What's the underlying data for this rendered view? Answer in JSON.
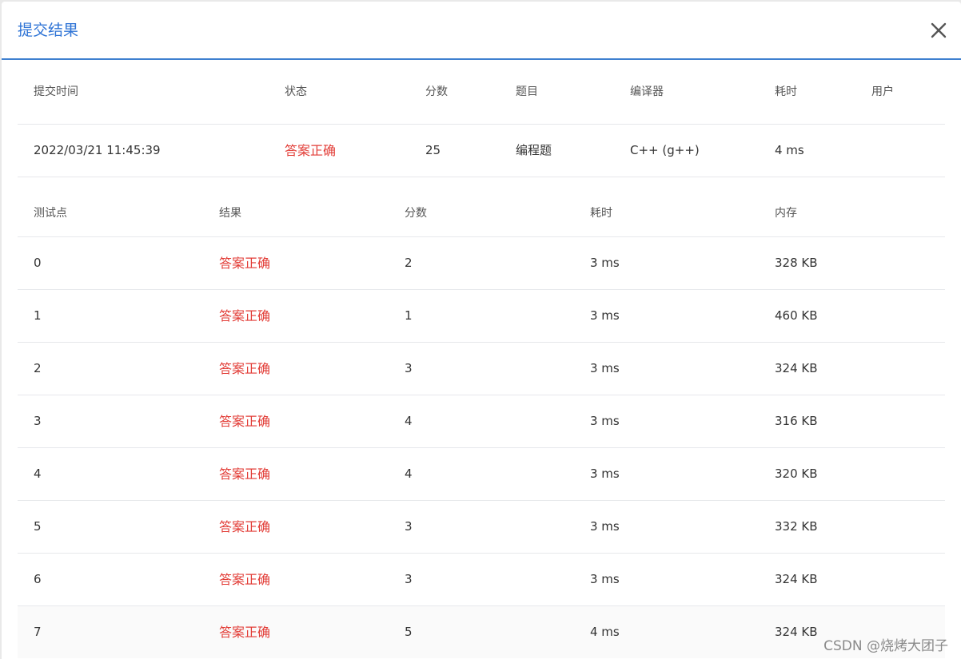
{
  "dialog": {
    "title": "提交结果"
  },
  "summary": {
    "headers": [
      "提交时间",
      "状态",
      "分数",
      "题目",
      "编译器",
      "耗时",
      "用户"
    ],
    "row": {
      "time": "2022/03/21 11:45:39",
      "status": "答案正确",
      "score": "25",
      "problem": "编程题",
      "compiler": "C++ (g++)",
      "elapsed": "4 ms",
      "user": ""
    }
  },
  "tests": {
    "headers": [
      "测试点",
      "结果",
      "分数",
      "耗时",
      "内存"
    ],
    "rows": [
      {
        "id": "0",
        "result": "答案正确",
        "score": "2",
        "time": "3 ms",
        "memory": "328 KB"
      },
      {
        "id": "1",
        "result": "答案正确",
        "score": "1",
        "time": "3 ms",
        "memory": "460 KB"
      },
      {
        "id": "2",
        "result": "答案正确",
        "score": "3",
        "time": "3 ms",
        "memory": "324 KB"
      },
      {
        "id": "3",
        "result": "答案正确",
        "score": "4",
        "time": "3 ms",
        "memory": "316 KB"
      },
      {
        "id": "4",
        "result": "答案正确",
        "score": "4",
        "time": "3 ms",
        "memory": "320 KB"
      },
      {
        "id": "5",
        "result": "答案正确",
        "score": "3",
        "time": "3 ms",
        "memory": "332 KB"
      },
      {
        "id": "6",
        "result": "答案正确",
        "score": "3",
        "time": "3 ms",
        "memory": "324 KB"
      },
      {
        "id": "7",
        "result": "答案正确",
        "score": "5",
        "time": "4 ms",
        "memory": "324 KB"
      }
    ]
  },
  "watermark": "CSDN @烧烤大团子",
  "icons": {
    "close": "close-icon"
  },
  "colors": {
    "title": "#2f74d6",
    "header_border": "#3f80d0",
    "status_ok": "#e23b35"
  }
}
